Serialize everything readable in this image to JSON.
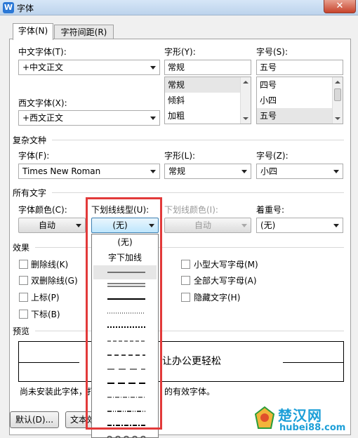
{
  "window": {
    "title": "字体",
    "app_icon": "W",
    "close_glyph": "✕"
  },
  "tabs": [
    {
      "label": "字体(N)"
    },
    {
      "label": "字符间距(R)"
    }
  ],
  "chinese_font": {
    "label": "中文字体(T):",
    "value": "+中文正文"
  },
  "western_font": {
    "label": "西文字体(X):",
    "value": "+西文正文"
  },
  "font_style": {
    "label": "字形(Y):",
    "value": "常规",
    "options": [
      "常规",
      "倾斜",
      "加粗"
    ],
    "selected_index": 0
  },
  "font_size": {
    "label": "字号(S):",
    "value": "五号",
    "options": [
      "四号",
      "小四",
      "五号"
    ],
    "selected_index": 2
  },
  "complex": {
    "group_title": "复杂文种",
    "font_label": "字体(F):",
    "font_value": "Times New Roman",
    "style_label": "字形(L):",
    "style_value": "常规",
    "size_label": "字号(Z):",
    "size_value": "小四"
  },
  "all_text": {
    "group_title": "所有文字",
    "font_color_label": "字体颜色(C):",
    "font_color_value": "自动",
    "underline_type_label": "下划线线型(U):",
    "underline_type_value": "(无)",
    "underline_color_label": "下划线颜色(I):",
    "underline_color_value": "自动",
    "emphasis_label": "着重号:",
    "emphasis_value": "(无)"
  },
  "effects": {
    "group_title": "效果",
    "left": [
      "删除线(K)",
      "双删除线(G)",
      "上标(P)",
      "下标(B)"
    ],
    "right": [
      "小型大写字母(M)",
      "全部大写字母(A)",
      "隐藏文字(H)"
    ]
  },
  "preview": {
    "group_title": "预览",
    "text": "让办公更轻松"
  },
  "note": {
    "left": "尚未安装此字体，打",
    "right": "的有效字体。"
  },
  "buttons": {
    "default": "默认(D)...",
    "text_effects": "文本效"
  },
  "underline_dropdown": {
    "text_options": [
      "(无)",
      "字下加线"
    ],
    "line_styles": [
      "single",
      "double",
      "thick",
      "dotted",
      "heavy-dotted",
      "dashed",
      "dash-sparse",
      "dash-long",
      "dash-dot",
      "dash-dot-dot",
      "heavy-dash-dot",
      "wave"
    ],
    "highlighted": "single"
  },
  "watermark": {
    "title": "楚汉网",
    "url": "hubei88.com"
  },
  "colors": {
    "highlight_border": "#e23a3a",
    "watermark": "#1d9fd8",
    "selected_row": "#e6e6e6"
  }
}
